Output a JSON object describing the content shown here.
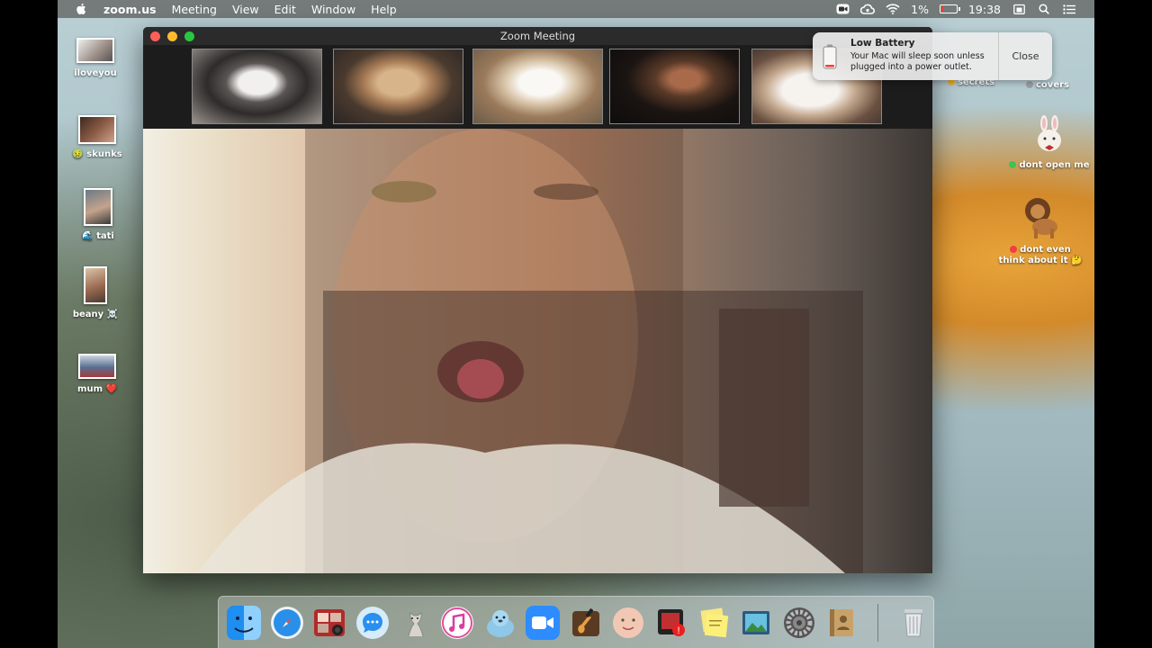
{
  "menubar": {
    "app_name": "zoom.us",
    "menus": [
      "Meeting",
      "View",
      "Edit",
      "Window",
      "Help"
    ],
    "battery_percent": "1%",
    "battery_fraction": 0.01,
    "time": "19:38"
  },
  "desktop": {
    "left_icons": [
      {
        "label": "iloveyou",
        "icon": "photo-icon"
      },
      {
        "label": "skunks",
        "prefix": "🤢",
        "icon": "photo-icon"
      },
      {
        "label": "tati",
        "prefix": "🌊",
        "icon": "photo-icon"
      },
      {
        "label": "beany",
        "suffix": "☠️",
        "icon": "photo-icon"
      },
      {
        "label": "mum",
        "suffix": "❤️",
        "icon": "photo-icon"
      }
    ],
    "right_icons": [
      {
        "label": "secrets",
        "dot_color": "#f1b233"
      },
      {
        "label": "covers",
        "dot_color": "#9aa0a6"
      },
      {
        "label": "dont open me",
        "dot_color": "#43c052"
      },
      {
        "label": "dont even think about it",
        "suffix": "🤔",
        "dot_color": "#ef4040"
      }
    ]
  },
  "zoom": {
    "window_title": "Zoom Meeting",
    "thumbnails": [
      "husky-dog",
      "poodle-dog",
      "terrier-dog",
      "man",
      "cat"
    ]
  },
  "notification": {
    "title": "Low Battery",
    "body": "Your Mac will sleep soon unless plugged into a power outlet.",
    "close_label": "Close"
  },
  "dock": {
    "apps": [
      "finder",
      "safari",
      "photo-booth",
      "messages",
      "unknown-app",
      "itunes",
      "seal-app",
      "zoom",
      "garageband",
      "face-app",
      "photo-app",
      "stickies",
      "preview",
      "system-preferences",
      "contacts"
    ],
    "trash": "trash"
  },
  "colors": {
    "traffic_red": "#fd5f57",
    "traffic_yellow": "#febb2e",
    "traffic_green": "#28c840",
    "battery_low": "#ff3b30"
  }
}
